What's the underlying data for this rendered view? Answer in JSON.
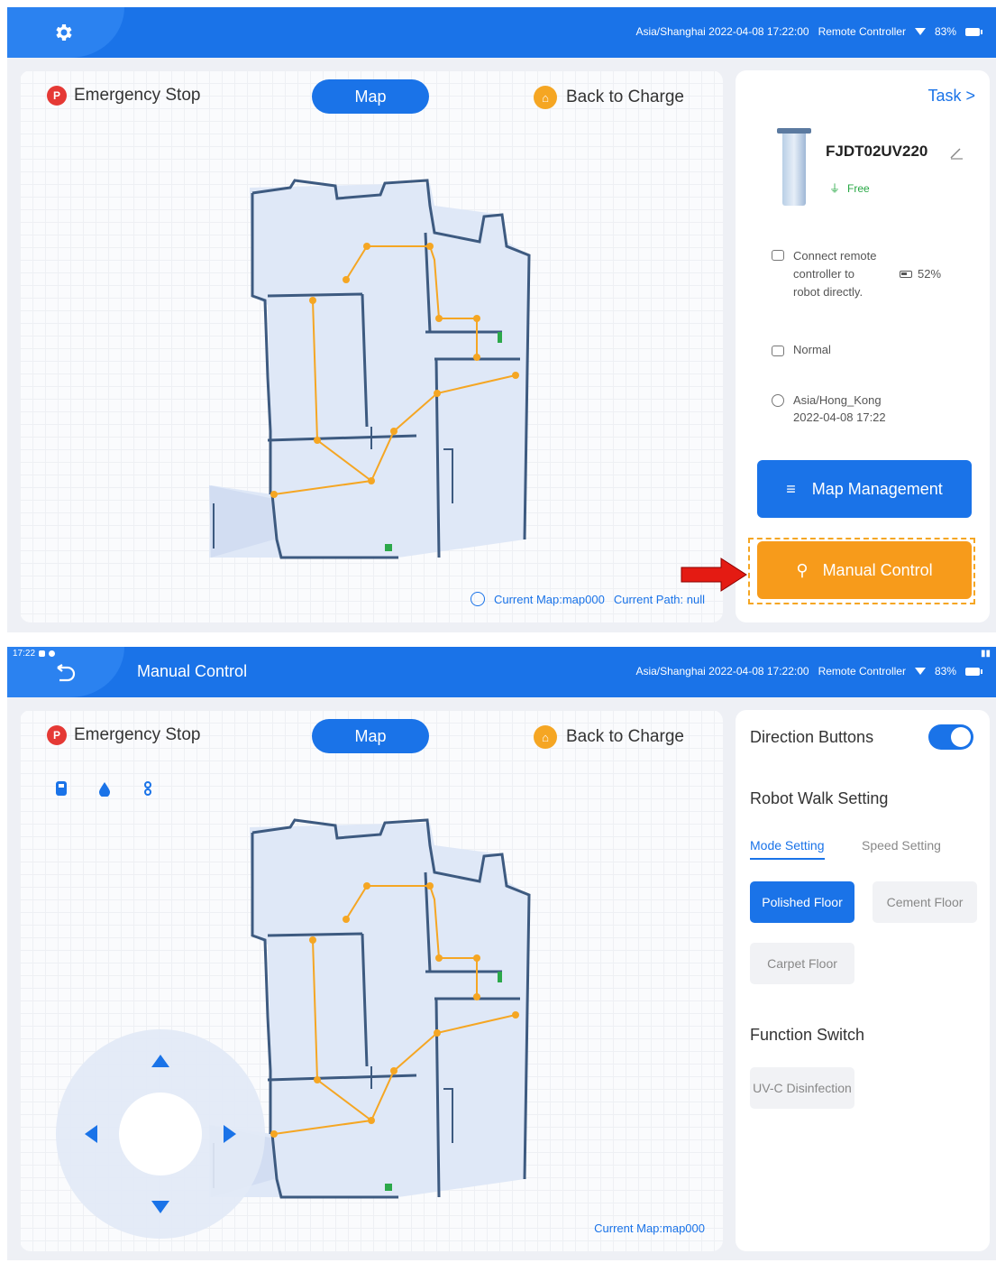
{
  "colors": {
    "primary": "#1a73e8",
    "accent": "#f79b1b",
    "danger": "#e53935",
    "path": "#f5a623"
  },
  "topbar": {
    "timezone_time": "Asia/Shanghai 2022-04-08 17:22:00",
    "controller": "Remote Controller",
    "battery": "83%"
  },
  "screen1": {
    "emergency_stop": "Emergency Stop",
    "estop_badge": "P",
    "map_tab": "Map",
    "back_to_charge": "Back to Charge",
    "current_map": "Current Map:map000",
    "current_path": "Current Path: null",
    "side": {
      "task_link": "Task >",
      "robot_name": "FJDT02UV220",
      "robot_status": "Free",
      "remote_hint": "Connect remote controller to robot directly.",
      "battery": "52%",
      "mode": "Normal",
      "timezone": "Asia/Hong_Kong",
      "datetime": "2022-04-08 17:22",
      "map_management": "Map Management",
      "manual_control": "Manual Control"
    }
  },
  "screen2": {
    "system_time": "17:22",
    "title": "Manual Control",
    "emergency_stop": "Emergency Stop",
    "estop_badge": "P",
    "map_tab": "Map",
    "back_to_charge": "Back to Charge",
    "current_map": "Current Map:map000",
    "panel": {
      "direction_buttons": "Direction Buttons",
      "direction_buttons_on": true,
      "robot_walk_setting": "Robot Walk Setting",
      "tab_mode": "Mode Setting",
      "tab_speed": "Speed Setting",
      "polished_floor": "Polished Floor",
      "cement_floor": "Cement Floor",
      "carpet_floor": "Carpet Floor",
      "function_switch": "Function Switch",
      "uvc_disinfection": "UV-C Disinfection"
    }
  },
  "icons": {
    "settings": "gear-icon",
    "back": "back-arrow-icon",
    "wifi": "wifi-icon",
    "battery": "battery-icon",
    "edit": "pencil-icon",
    "direction": [
      "arrow-up-icon",
      "arrow-down-icon",
      "arrow-left-icon",
      "arrow-right-icon"
    ]
  }
}
